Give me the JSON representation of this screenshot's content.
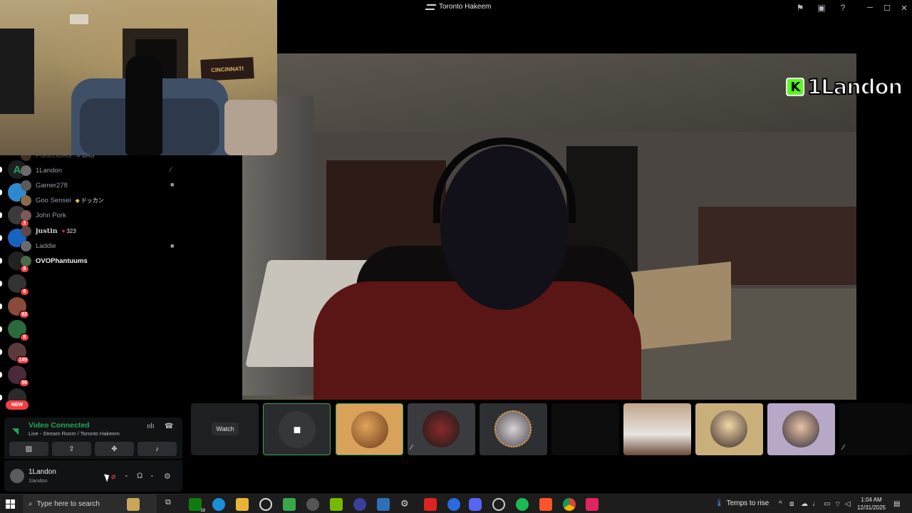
{
  "window": {
    "title": "Toronto Hakeem",
    "icons": [
      "inbox-icon",
      "monitor-icon",
      "help-icon"
    ]
  },
  "stage": {
    "overlay_name": "1Landon",
    "overlay_logo": "K"
  },
  "pip": {
    "sign_text": "CINCINNATI"
  },
  "servers": [
    {
      "icon": "a-icon",
      "badge": ""
    },
    {
      "icon": "monkey-icon",
      "badge": "8"
    },
    {
      "icon": "music-icon",
      "badge": "2"
    },
    {
      "icon": "blue-icon",
      "badge": "3"
    },
    {
      "icon": "flower-icon",
      "badge": "8"
    },
    {
      "icon": "bmw-icon",
      "badge": "6"
    },
    {
      "icon": "face-icon",
      "badge": "92"
    },
    {
      "icon": "green-icon",
      "badge": "8"
    },
    {
      "icon": "rapper-icon",
      "badge": "149"
    },
    {
      "icon": "skull-icon",
      "badge": "56"
    },
    {
      "icon": "gewn-icon",
      "badge": ""
    }
  ],
  "rail_new_label": "NEW",
  "members": [
    {
      "name": "1Landon",
      "tag": "",
      "status_icon": "muted-icon"
    },
    {
      "name": "Gamer278",
      "tag": "",
      "status_icon": "video-icon"
    },
    {
      "name": "Goo Sensei",
      "tag": "ドッカン",
      "status_icon": ""
    },
    {
      "name": "John Pork",
      "tag": "",
      "status_icon": ""
    },
    {
      "name": "justin",
      "tag": "323",
      "status_icon": ""
    },
    {
      "name": "Laddie",
      "tag": "",
      "status_icon": "video-icon"
    },
    {
      "name": "OVOPhantuums",
      "tag": "",
      "status_icon": ""
    }
  ],
  "member_partial": {
    "name": "PGucciBAG",
    "tag": "BAG"
  },
  "tiles": {
    "watch_label": "Watch"
  },
  "voice": {
    "title": "Video Connected",
    "subtitle": "Live - Stream Room / Toronto Hakeem"
  },
  "user": {
    "name": "1Landon",
    "tag": "1landon"
  },
  "taskbar": {
    "search_placeholder": "Type here to search",
    "xbox_badge": "18",
    "weather": "Temps to rise",
    "time": "1:04 AM",
    "date": "12/31/2025"
  }
}
